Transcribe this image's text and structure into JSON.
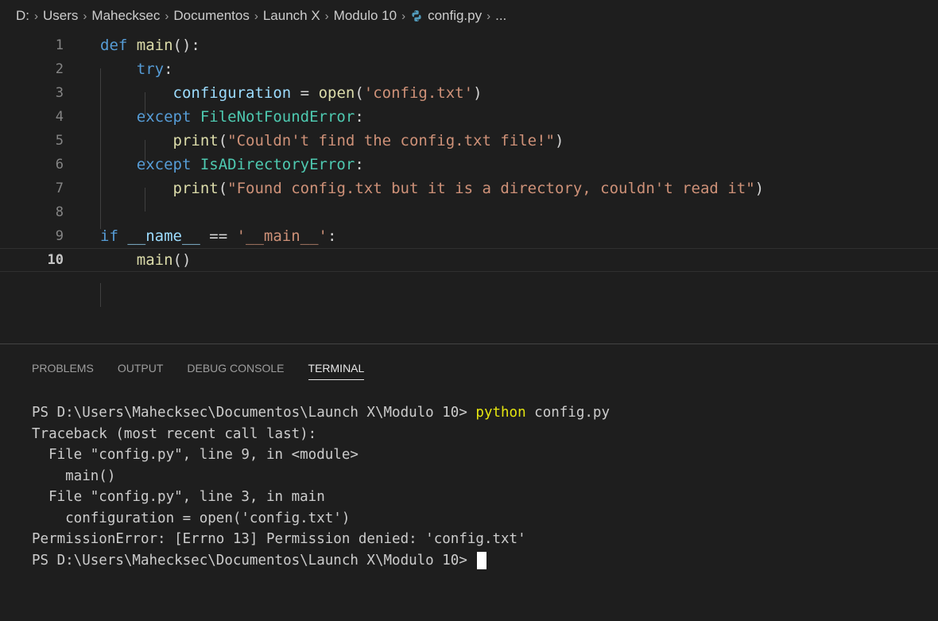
{
  "breadcrumb": {
    "items": [
      "D:",
      "Users",
      "Mahecksec",
      "Documentos",
      "Launch X",
      "Modulo 10"
    ],
    "file": "config.py",
    "more": "...",
    "separator": "›",
    "file_icon": "python-icon"
  },
  "editor": {
    "lines": [
      {
        "num": "1",
        "tokens": [
          {
            "t": "def ",
            "c": "kw"
          },
          {
            "t": "main",
            "c": "fn"
          },
          {
            "t": "():",
            "c": "plain"
          }
        ]
      },
      {
        "num": "2",
        "tokens": [
          {
            "t": "    ",
            "c": "plain"
          },
          {
            "t": "try",
            "c": "ctrl"
          },
          {
            "t": ":",
            "c": "plain"
          }
        ]
      },
      {
        "num": "3",
        "tokens": [
          {
            "t": "        ",
            "c": "plain"
          },
          {
            "t": "configuration",
            "c": "var"
          },
          {
            "t": " = ",
            "c": "plain"
          },
          {
            "t": "open",
            "c": "fn"
          },
          {
            "t": "(",
            "c": "plain"
          },
          {
            "t": "'config.txt'",
            "c": "str"
          },
          {
            "t": ")",
            "c": "plain"
          }
        ]
      },
      {
        "num": "4",
        "tokens": [
          {
            "t": "    ",
            "c": "plain"
          },
          {
            "t": "except ",
            "c": "ctrl"
          },
          {
            "t": "FileNotFoundError",
            "c": "cls"
          },
          {
            "t": ":",
            "c": "plain"
          }
        ]
      },
      {
        "num": "5",
        "tokens": [
          {
            "t": "        ",
            "c": "plain"
          },
          {
            "t": "print",
            "c": "fn"
          },
          {
            "t": "(",
            "c": "plain"
          },
          {
            "t": "\"Couldn't find the config.txt file!\"",
            "c": "str"
          },
          {
            "t": ")",
            "c": "plain"
          }
        ]
      },
      {
        "num": "6",
        "tokens": [
          {
            "t": "    ",
            "c": "plain"
          },
          {
            "t": "except ",
            "c": "ctrl"
          },
          {
            "t": "IsADirectoryError",
            "c": "cls"
          },
          {
            "t": ":",
            "c": "plain"
          }
        ]
      },
      {
        "num": "7",
        "tokens": [
          {
            "t": "        ",
            "c": "plain"
          },
          {
            "t": "print",
            "c": "fn"
          },
          {
            "t": "(",
            "c": "plain"
          },
          {
            "t": "\"Found config.txt but it is a directory, couldn't read it\"",
            "c": "str"
          },
          {
            "t": ")",
            "c": "plain"
          }
        ]
      },
      {
        "num": "8",
        "tokens": []
      },
      {
        "num": "9",
        "tokens": [
          {
            "t": "if ",
            "c": "ctrl"
          },
          {
            "t": "__name__",
            "c": "var"
          },
          {
            "t": " == ",
            "c": "plain"
          },
          {
            "t": "'__main__'",
            "c": "str"
          },
          {
            "t": ":",
            "c": "plain"
          }
        ]
      },
      {
        "num": "10",
        "tokens": [
          {
            "t": "    ",
            "c": "plain"
          },
          {
            "t": "main",
            "c": "fn"
          },
          {
            "t": "()",
            "c": "plain"
          }
        ]
      }
    ],
    "current_line": "10"
  },
  "panel": {
    "tabs": [
      {
        "label": "PROBLEMS",
        "active": false
      },
      {
        "label": "OUTPUT",
        "active": false
      },
      {
        "label": "DEBUG CONSOLE",
        "active": false
      },
      {
        "label": "TERMINAL",
        "active": true
      }
    ]
  },
  "terminal": {
    "prompt1": "PS D:\\Users\\Mahecksec\\Documentos\\Launch X\\Modulo 10> ",
    "command": "python",
    "command_args": " config.py",
    "output": [
      "Traceback (most recent call last):",
      "  File \"config.py\", line 9, in <module>",
      "    main()",
      "  File \"config.py\", line 3, in main",
      "    configuration = open('config.txt')",
      "PermissionError: [Errno 13] Permission denied: 'config.txt'"
    ],
    "prompt2": "PS D:\\Users\\Mahecksec\\Documentos\\Launch X\\Modulo 10> "
  }
}
